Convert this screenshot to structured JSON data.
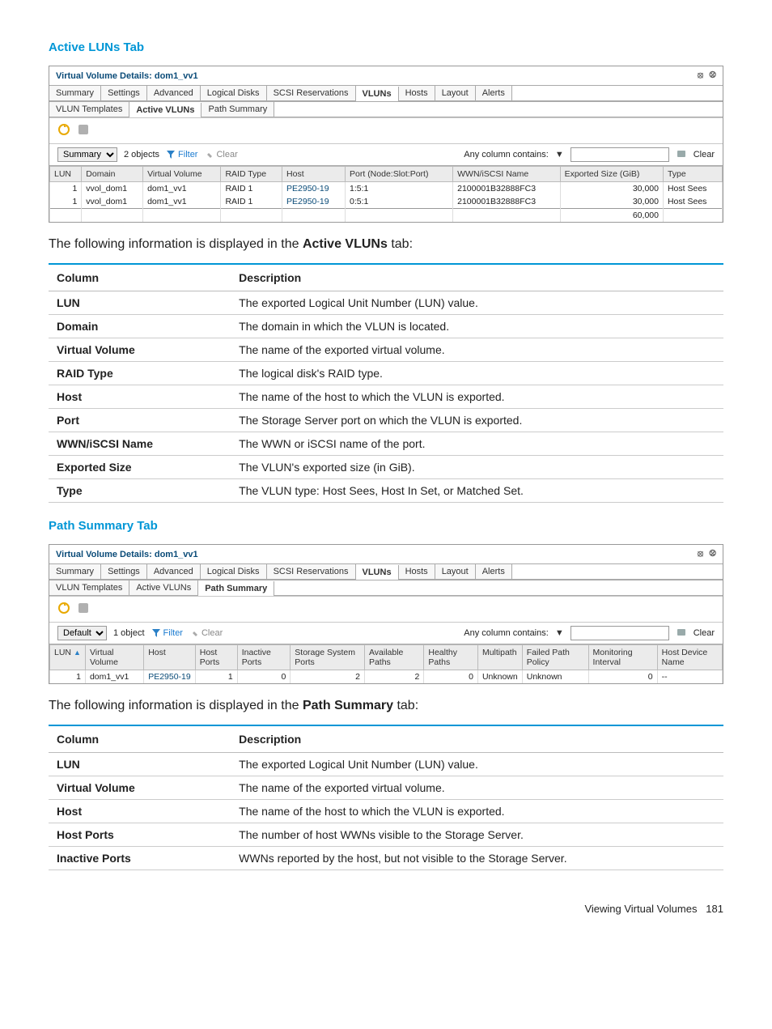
{
  "section1": {
    "title": "Active LUNs Tab"
  },
  "section2": {
    "title": "Path Summary Tab"
  },
  "intro1_prefix": "The following information is displayed in the ",
  "intro1_bold": "Active VLUNs",
  "intro1_suffix": " tab:",
  "intro2_prefix": "The following information is displayed in the ",
  "intro2_bold": "Path Summary",
  "intro2_suffix": " tab:",
  "panel1": {
    "title": "Virtual Volume Details: dom1_vv1",
    "tabs_top": [
      "Summary",
      "Settings",
      "Advanced",
      "Logical Disks",
      "SCSI Reservations",
      "VLUNs",
      "Hosts",
      "Layout",
      "Alerts"
    ],
    "tabs_top_selected": 5,
    "tabs_sub": [
      "VLUN Templates",
      "Active VLUNs",
      "Path Summary"
    ],
    "tabs_sub_selected": 1,
    "filter": {
      "mode": "Summary",
      "count": "2 objects",
      "filter_label": "Filter",
      "clear_label": "Clear",
      "contains_label": "Any column contains:",
      "clear_right": "Clear"
    },
    "grid": {
      "cols": [
        "LUN",
        "Domain",
        "Virtual Volume",
        "RAID Type",
        "Host",
        "Port (Node:Slot:Port)",
        "WWN/iSCSI Name",
        "Exported Size (GiB)",
        "Type"
      ],
      "rows": [
        {
          "lun": "1",
          "domain": "vvol_dom1",
          "vv": "dom1_vv1",
          "raid": "RAID 1",
          "host": "PE2950-19",
          "port": "1:5:1",
          "wwn": "2100001B32888FC3",
          "size": "30,000",
          "type": "Host Sees"
        },
        {
          "lun": "1",
          "domain": "vvol_dom1",
          "vv": "dom1_vv1",
          "raid": "RAID 1",
          "host": "PE2950-19",
          "port": "0:5:1",
          "wwn": "2100001B32888FC3",
          "size": "30,000",
          "type": "Host Sees"
        }
      ],
      "total_size": "60,000"
    }
  },
  "panel2": {
    "title": "Virtual Volume Details: dom1_vv1",
    "tabs_top": [
      "Summary",
      "Settings",
      "Advanced",
      "Logical Disks",
      "SCSI Reservations",
      "VLUNs",
      "Hosts",
      "Layout",
      "Alerts"
    ],
    "tabs_top_selected": 5,
    "tabs_sub": [
      "VLUN Templates",
      "Active VLUNs",
      "Path Summary"
    ],
    "tabs_sub_selected": 2,
    "filter": {
      "mode": "Default",
      "count": "1 object",
      "filter_label": "Filter",
      "clear_label": "Clear",
      "contains_label": "Any column contains:",
      "clear_right": "Clear"
    },
    "grid": {
      "cols": [
        "LUN",
        "Virtual Volume",
        "Host",
        "Host Ports",
        "Inactive Ports",
        "Storage System Ports",
        "Available Paths",
        "Healthy Paths",
        "Multipath",
        "Failed Path Policy",
        "Monitoring Interval",
        "Host Device Name"
      ],
      "rows": [
        {
          "lun": "1",
          "vv": "dom1_vv1",
          "host": "PE2950-19",
          "hostports": "1",
          "inactive": "0",
          "storage": "2",
          "avail": "2",
          "healthy": "0",
          "multipath": "Unknown",
          "failed": "Unknown",
          "monitor": "0",
          "devname": "--"
        }
      ]
    }
  },
  "doc1": {
    "head_col": "Column",
    "head_desc": "Description",
    "rows": [
      {
        "c": "LUN",
        "d": "The exported Logical Unit Number (LUN) value."
      },
      {
        "c": "Domain",
        "d": "The domain in which the VLUN is located."
      },
      {
        "c": "Virtual Volume",
        "d": "The name of the exported virtual volume."
      },
      {
        "c": "RAID Type",
        "d": "The logical disk's RAID type."
      },
      {
        "c": "Host",
        "d": "The name of the host to which the VLUN is exported."
      },
      {
        "c": "Port",
        "d": "The Storage Server port on which the VLUN is exported."
      },
      {
        "c": "WWN/iSCSI Name",
        "d": "The WWN or iSCSI name of the port."
      },
      {
        "c": "Exported Size",
        "d": "The VLUN's exported size (in GiB)."
      },
      {
        "c": "Type",
        "d": "The VLUN type: Host Sees, Host In Set, or Matched Set."
      }
    ]
  },
  "doc2": {
    "head_col": "Column",
    "head_desc": "Description",
    "rows": [
      {
        "c": "LUN",
        "d": "The exported Logical Unit Number (LUN) value."
      },
      {
        "c": "Virtual Volume",
        "d": "The name of the exported virtual volume."
      },
      {
        "c": "Host",
        "d": "The name of the host to which the VLUN is exported."
      },
      {
        "c": "Host Ports",
        "d": "The number of host WWNs visible to the Storage Server."
      },
      {
        "c": "Inactive Ports",
        "d": "WWNs reported by the host, but not visible to the Storage Server."
      }
    ]
  },
  "footer": {
    "label": "Viewing Virtual Volumes",
    "page": "181"
  }
}
